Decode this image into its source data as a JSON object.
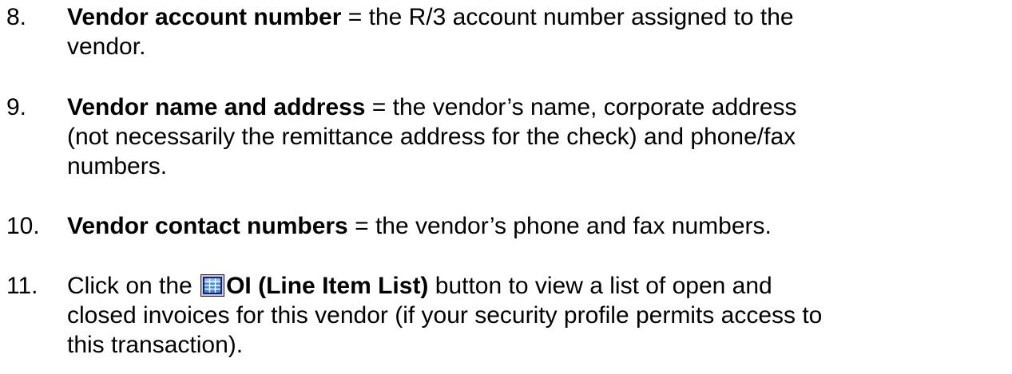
{
  "items": [
    {
      "number": "8.",
      "term": "Vendor account number",
      "definition": " = the R/3 account number assigned to the",
      "definition_line2": "vendor."
    },
    {
      "number": "9.",
      "term": "Vendor name and address",
      "definition": " = the vendor’s name, corporate address",
      "definition_line2": "(not necessarily the remittance address for the check) and phone/fax",
      "definition_line3": "numbers."
    },
    {
      "number": "10.",
      "term": "Vendor contact numbers",
      "definition": " = the vendor’s phone and fax numbers."
    },
    {
      "number": "11.",
      "prefix": "Click on the ",
      "icon": "line-item-list-icon",
      "button_label": "OI (Line Item List)",
      "suffix": " button to view a list of open and",
      "line2": "closed invoices for this vendor (if your security profile permits access to",
      "line3": "this transaction)."
    }
  ],
  "colors": {
    "text": "#000000",
    "icon_frame": "#1a1a8c",
    "icon_fill": "#3a8fd8",
    "icon_grid": "#ffffff"
  }
}
